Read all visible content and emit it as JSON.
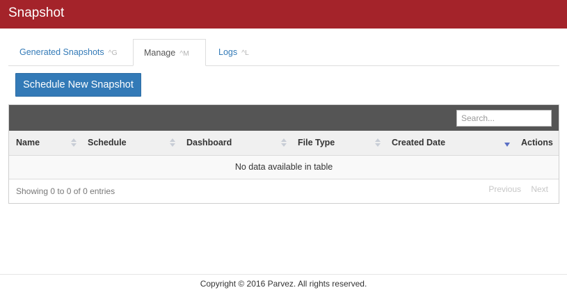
{
  "header": {
    "title": "Snapshot",
    "bar_color": "#a4232a"
  },
  "tabs": [
    {
      "label": "Generated Snapshots",
      "shortcut": "^G",
      "active": false
    },
    {
      "label": "Manage",
      "shortcut": "^M",
      "active": true
    },
    {
      "label": "Logs",
      "shortcut": "^L",
      "active": false
    }
  ],
  "actions": {
    "schedule_button": "Schedule New Snapshot",
    "button_color": "#337ab7"
  },
  "table": {
    "search_placeholder": "Search...",
    "columns": [
      "Name",
      "Schedule",
      "Dashboard",
      "File Type",
      "Created Date",
      "Actions"
    ],
    "sorted_column": "Created Date",
    "sort_direction": "descending",
    "empty_message": "No data available in table",
    "info": "Showing 0 to 0 of 0 entries",
    "pagination": {
      "previous": "Previous",
      "next": "Next"
    }
  },
  "footer": {
    "copyright": "Copyright © 2016 Parvez. All rights reserved."
  }
}
